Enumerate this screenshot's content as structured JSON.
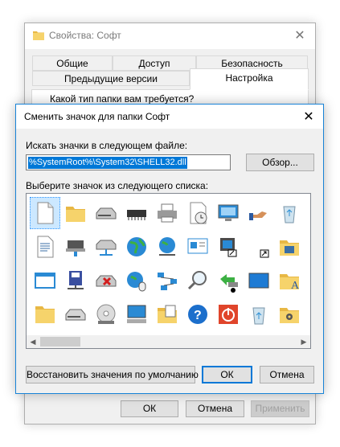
{
  "background_window": {
    "title": "Свойства: Софт",
    "tabs_row1": [
      "Общие",
      "Доступ",
      "Безопасность"
    ],
    "tabs_row2": [
      "Предыдущие версии",
      "Настройка"
    ],
    "active_tab": "Настройка",
    "question": "Какой тип папки вам требуется?",
    "buttons": {
      "ok": "ОК",
      "cancel": "Отмена",
      "apply": "Применить"
    }
  },
  "dialog": {
    "title": "Сменить значок для папки Софт",
    "file_label": "Искать значки в следующем файле:",
    "file_path": "%SystemRoot%\\System32\\SHELL32.dll",
    "browse_label": "Обзор...",
    "list_label": "Выберите значок из следующего списка:",
    "icons": [
      {
        "name": "blank-document-icon",
        "row": 0,
        "col": 0
      },
      {
        "name": "folder-icon",
        "row": 0,
        "col": 1
      },
      {
        "name": "drive-icon",
        "row": 0,
        "col": 2
      },
      {
        "name": "memory-chip-icon",
        "row": 0,
        "col": 3
      },
      {
        "name": "printer-icon",
        "row": 0,
        "col": 4
      },
      {
        "name": "clock-document-icon",
        "row": 0,
        "col": 5
      },
      {
        "name": "display-icon",
        "row": 0,
        "col": 6
      },
      {
        "name": "hand-share-icon",
        "row": 0,
        "col": 7
      },
      {
        "name": "recycle-bin-icon",
        "row": 0,
        "col": 8
      },
      {
        "name": "folder-doc-icon",
        "row": 0,
        "col": 9
      },
      {
        "name": "text-document-icon",
        "row": 1,
        "col": 0
      },
      {
        "name": "network-computer-icon",
        "row": 1,
        "col": 1
      },
      {
        "name": "network-drive-icon",
        "row": 1,
        "col": 2
      },
      {
        "name": "globe-icon",
        "row": 1,
        "col": 3
      },
      {
        "name": "network-globe-icon",
        "row": 1,
        "col": 4
      },
      {
        "name": "control-panel-icon",
        "row": 1,
        "col": 5
      },
      {
        "name": "cd-drive-shortcut-icon",
        "row": 1,
        "col": 6
      },
      {
        "name": "shortcut-arrow-icon",
        "row": 1,
        "col": 7
      },
      {
        "name": "folder-programs-icon",
        "row": 1,
        "col": 8
      },
      {
        "name": "printer-folder-icon",
        "row": 1,
        "col": 9
      },
      {
        "name": "window-icon",
        "row": 2,
        "col": 0
      },
      {
        "name": "floppy-network-icon",
        "row": 2,
        "col": 1
      },
      {
        "name": "drive-error-icon",
        "row": 2,
        "col": 2
      },
      {
        "name": "globe-mouse-icon",
        "row": 2,
        "col": 3
      },
      {
        "name": "network-map-icon",
        "row": 2,
        "col": 4
      },
      {
        "name": "search-icon",
        "row": 2,
        "col": 5
      },
      {
        "name": "arrow-shortcut-drive-icon",
        "row": 2,
        "col": 6
      },
      {
        "name": "desktop-icon",
        "row": 2,
        "col": 7
      },
      {
        "name": "font-folder-icon",
        "row": 2,
        "col": 8
      },
      {
        "name": "folder-yellow-icon",
        "row": 3,
        "col": 0
      },
      {
        "name": "drive-gray-icon",
        "row": 3,
        "col": 1
      },
      {
        "name": "cd-disc-icon",
        "row": 3,
        "col": 2
      },
      {
        "name": "monitor-computer-icon",
        "row": 3,
        "col": 3
      },
      {
        "name": "calculator-folder-icon",
        "row": 3,
        "col": 4
      },
      {
        "name": "help-icon",
        "row": 3,
        "col": 5
      },
      {
        "name": "power-icon",
        "row": 3,
        "col": 6
      },
      {
        "name": "recycle-full-icon",
        "row": 3,
        "col": 7
      },
      {
        "name": "folder-gear-icon",
        "row": 3,
        "col": 8
      },
      {
        "name": "checklist-icon",
        "row": 3,
        "col": 9
      }
    ],
    "selected_index": 0,
    "restore_label": "Восстановить значения по умолчанию",
    "ok_label": "ОК",
    "cancel_label": "Отмена"
  },
  "colors": {
    "accent": "#0078d7",
    "folder": "#f6d36b"
  }
}
